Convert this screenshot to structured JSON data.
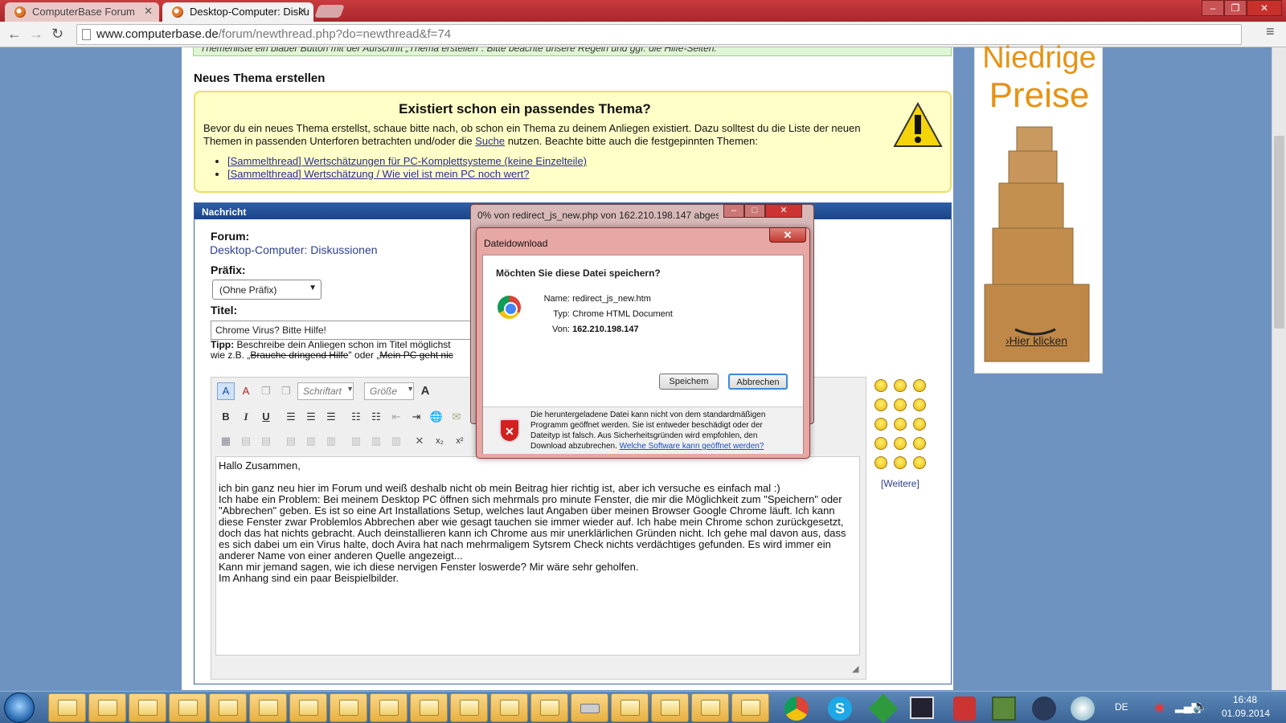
{
  "browser": {
    "tabs": [
      {
        "label": "ComputerBase Forum"
      },
      {
        "label": "Desktop-Computer: Disku"
      }
    ],
    "url_host": "www.computerbase.de",
    "url_path": "/forum/newthread.php?do=newthread&f=74",
    "window_buttons": {
      "min": "–",
      "max": "❐",
      "close": "✕"
    }
  },
  "page": {
    "top_notice": "Themenliste ein blauer Button mit der Aufschrift „Thema erstellen\". Bitte beachte unsere Regeln und ggf. die Hilfe-Seiten.",
    "heading": "Neues Thema erstellen",
    "hint": {
      "title": "Existiert schon ein passendes Thema?",
      "text_before": "Bevor du ein neues Thema erstellst, schaue bitte nach, ob schon ein Thema zu deinem Anliegen existiert. Dazu solltest du die Liste der neuen Themen in passenden Unterforen betrachten und/oder die ",
      "link": "Suche",
      "text_after": " nutzen. Beachte bitte auch die festgepinnten Themen:",
      "threads": [
        "[Sammelthread] Wertschätzungen für PC-Komplettsysteme (keine Einzelteile)",
        "[Sammelthread] Wertschätzung / Wie viel ist mein PC noch wert?"
      ]
    },
    "panel_header": "Nachricht",
    "forum_label": "Forum:",
    "forum_value": "Desktop-Computer: Diskussionen",
    "prefix_label": "Präfix:",
    "prefix_value": "(Ohne Präfix)",
    "title_label": "Titel:",
    "title_value": "Chrome Virus? Bitte Hilfe!",
    "tip_label": "Tipp:",
    "tip_line1": " Beschreibe dein Anliegen schon im Titel möglichst",
    "tip_line2_a": "wie z.B. „",
    "tip_line2_b": "Brauche dringend Hilfe",
    "tip_line2_c": "\" oder „",
    "tip_line2_d": "Mein PC geht nic",
    "editor": {
      "font_select": "Schriftart",
      "size_select": "Größe",
      "body": "Hallo Zusammen,\n\nich bin ganz neu hier im Forum und weiß deshalb nicht ob mein Beitrag hier richtig ist, aber ich versuche es einfach mal :)\nIch habe ein Problem: Bei meinem Desktop PC öffnen sich mehrmals pro minute Fenster, die mir die Möglichkeit zum \"Speichern\" oder \"Abbrechen\" geben. Es ist so eine Art Installations Setup, welches laut Angaben über meinen Browser Google Chrome läuft. Ich kann diese Fenster zwar Problemlos Abbrechen aber wie gesagt tauchen sie immer wieder auf. Ich habe mein Chrome schon zurückgesetzt, doch das hat nichts gebracht. Auch deinstallieren kann ich Chrome aus mir unerklärlichen Gründen nicht. Ich gehe mal davon aus, dass es sich dabei um ein Virus halte, doch Avira hat nach mehrmaligem Sytsrem Check nichts verdächtiges gefunden. Es wird immer ein anderer Name von einer anderen Quelle angezeigt...\nKann mir jemand sagen, wie ich diese nervigen Fenster loswerde? Mir wäre sehr geholfen.\nIm Anhang sind ein paar Beispielbilder."
    },
    "smilies_more": "[Weitere]"
  },
  "ad": {
    "line1": "Niedrige",
    "line2": "Preise",
    "link": "Hier klicken"
  },
  "progress_window": {
    "title": "0% von redirect_js_new.php von 162.210.198.147 abgesc..."
  },
  "dialog": {
    "title": "Dateidownload",
    "question": "Möchten Sie diese Datei speichern?",
    "name_label": "Name:",
    "name_value": "redirect_js_new.htm",
    "type_label": "Typ:",
    "type_value": "Chrome HTML Document",
    "from_label": "Von:",
    "from_value": "162.210.198.147",
    "save_button": "Speichem",
    "cancel_button": "Abbrechen",
    "warning": "Die heruntergeladene Datei kann nicht von dem standardmäßigen Programm geöffnet werden. Sie ist entweder beschädigt oder der Dateityp ist falsch. Aus Sicherheitsgründen wird empfohlen, den Download abzubrechen. ",
    "warning_link": "Welche Software kann geöffnet werden?"
  },
  "taskbar": {
    "language": "DE",
    "time": "16:48",
    "date": "01.09.2014"
  },
  "colors": {
    "chrome_frame": "#c93a3e",
    "hint_bg": "#ffffc8",
    "panel_header": "#1a4588",
    "ad_text": "#e59314"
  }
}
